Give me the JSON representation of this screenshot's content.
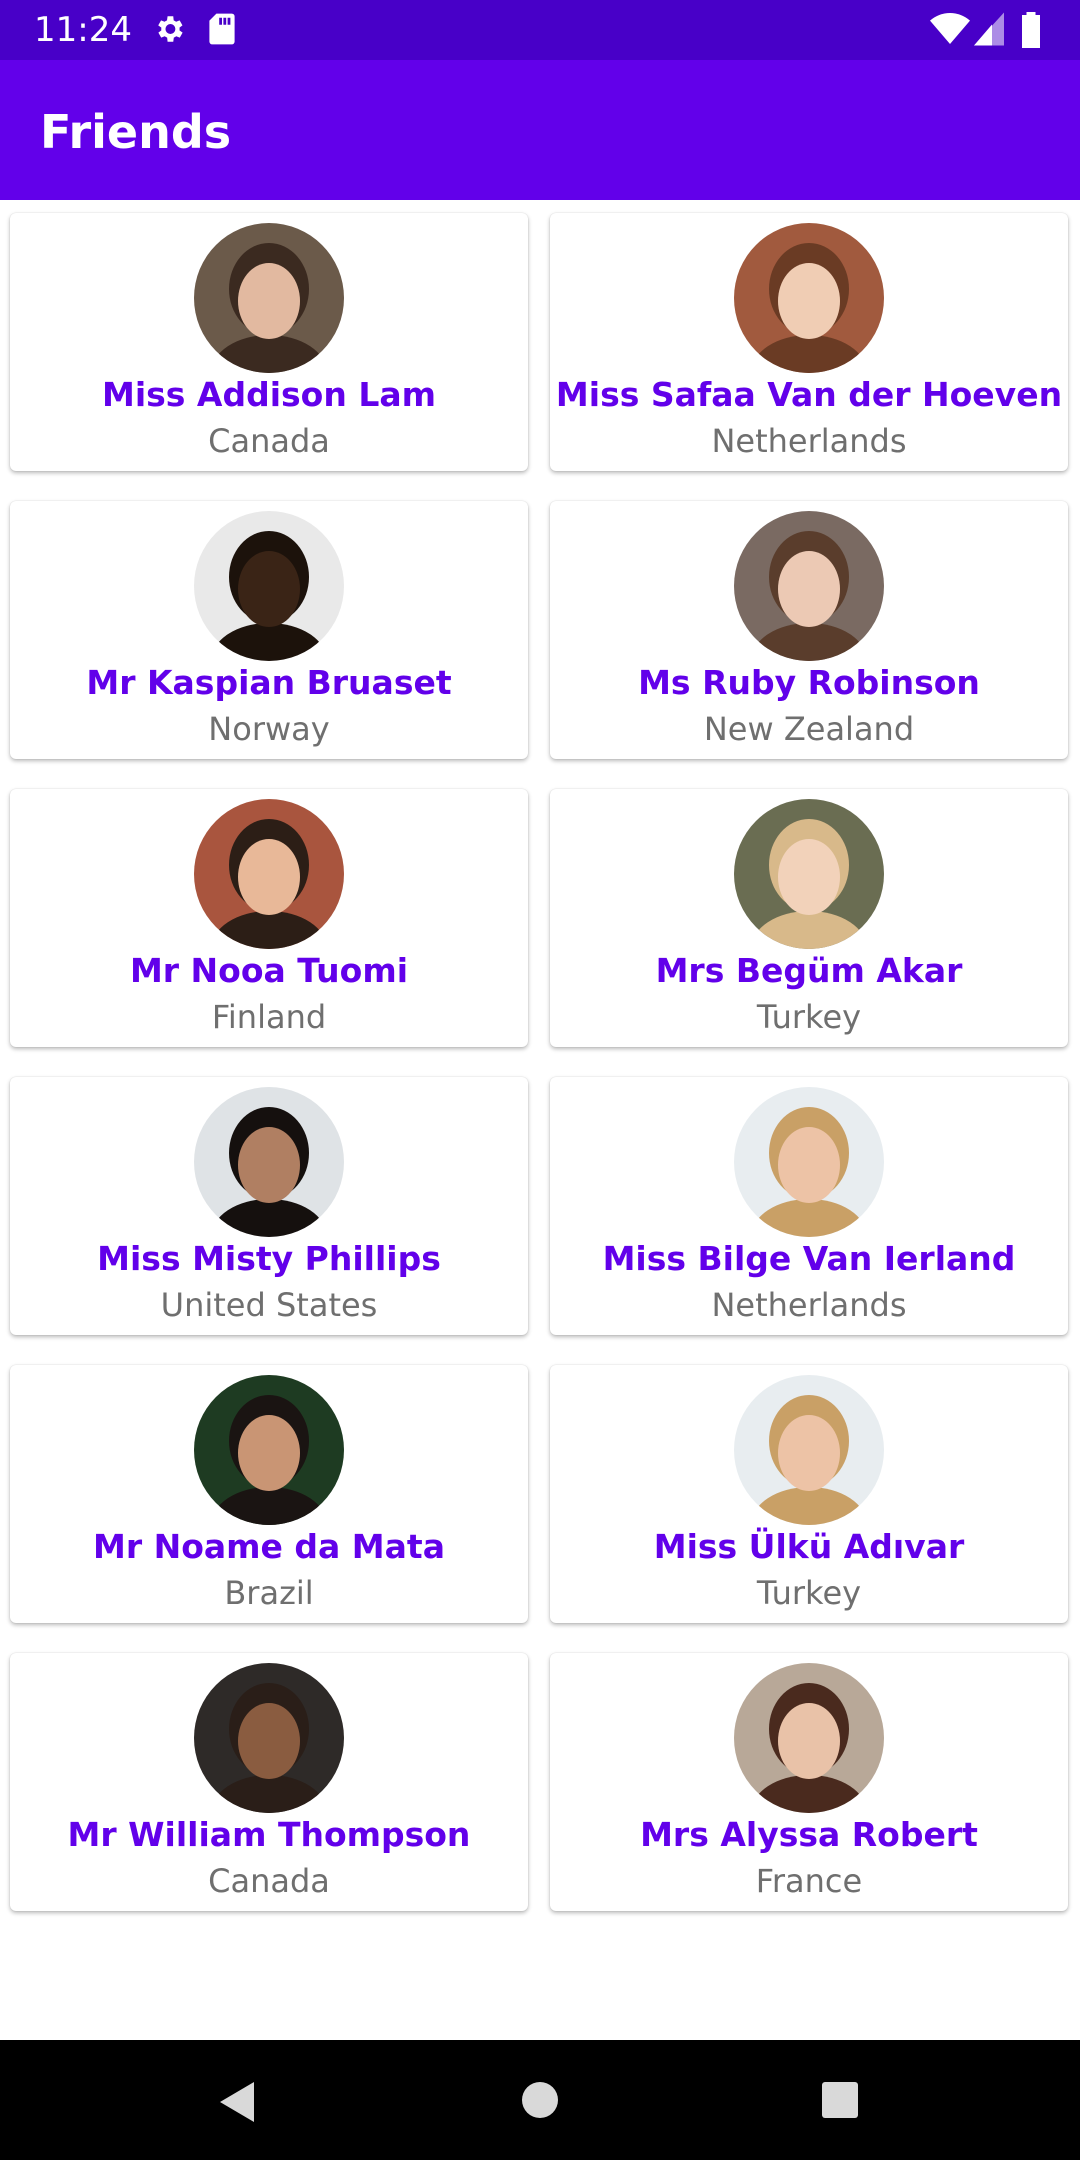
{
  "status_bar": {
    "time": "11:24",
    "icons": [
      "settings-icon",
      "sd-card-icon",
      "wifi-icon",
      "signal-icon",
      "battery-icon"
    ]
  },
  "app_bar": {
    "title": "Friends"
  },
  "colors": {
    "status_bar": "#4800c8",
    "app_bar": "#6200ea",
    "name_text": "#6200ea",
    "country_text": "#6f6f6f"
  },
  "friends": [
    {
      "name": "Miss Addison Lam",
      "country": "Canada",
      "avatar_bg": "#6b5a4a",
      "avatar_face": "#e2b9a0",
      "avatar_hair": "#3b2a20"
    },
    {
      "name": "Miss Safaa Van der Hoeven",
      "country": "Netherlands",
      "avatar_bg": "#a15a3e",
      "avatar_face": "#f0cdb4",
      "avatar_hair": "#6a3b24"
    },
    {
      "name": "Mr Kaspian Bruaset",
      "country": "Norway",
      "avatar_bg": "#e9e9e9",
      "avatar_face": "#3a2416",
      "avatar_hair": "#1c120b"
    },
    {
      "name": "Ms Ruby Robinson",
      "country": "New Zealand",
      "avatar_bg": "#7a6a62",
      "avatar_face": "#ecc9b4",
      "avatar_hair": "#5a3d2c"
    },
    {
      "name": "Mr Nooa Tuomi",
      "country": "Finland",
      "avatar_bg": "#a9553e",
      "avatar_face": "#e8b898",
      "avatar_hair": "#2c1e16"
    },
    {
      "name": "Mrs Begüm Akar",
      "country": "Turkey",
      "avatar_bg": "#6a6d52",
      "avatar_face": "#f2d2ba",
      "avatar_hair": "#d8b98a"
    },
    {
      "name": "Miss Misty Phillips",
      "country": "United States",
      "avatar_bg": "#dfe3e6",
      "avatar_face": "#b07f62",
      "avatar_hair": "#15100e"
    },
    {
      "name": "Miss Bilge Van Ierland",
      "country": "Netherlands",
      "avatar_bg": "#e8edf0",
      "avatar_face": "#edc3a6",
      "avatar_hair": "#c9a066"
    },
    {
      "name": "Mr Noame da Mata",
      "country": "Brazil",
      "avatar_bg": "#1e3b22",
      "avatar_face": "#c99574",
      "avatar_hair": "#1a1412"
    },
    {
      "name": "Miss Ülkü Adıvar",
      "country": "Turkey",
      "avatar_bg": "#e8edf0",
      "avatar_face": "#edc3a6",
      "avatar_hair": "#c9a066"
    },
    {
      "name": "Mr William Thompson",
      "country": "Canada",
      "avatar_bg": "#2e2a28",
      "avatar_face": "#8a5c40",
      "avatar_hair": "#2a1e18"
    },
    {
      "name": "Mrs Alyssa Robert",
      "country": "France",
      "avatar_bg": "#b8a898",
      "avatar_face": "#e9c2a8",
      "avatar_hair": "#4a2a1e"
    }
  ],
  "nav_bar": {
    "back_icon": "back-triangle-icon",
    "home_icon": "home-circle-icon",
    "recents_icon": "recents-square-icon"
  }
}
